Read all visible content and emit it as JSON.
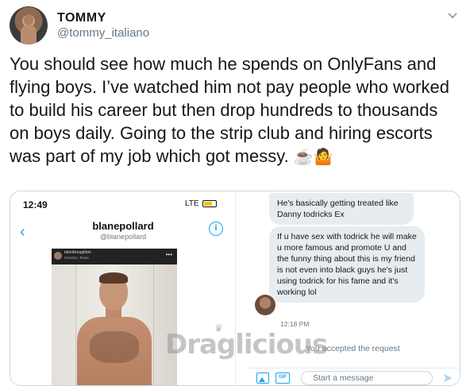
{
  "tweet": {
    "display_name": "TOMMY",
    "handle": "@tommy_italiano",
    "text": "You should see how much he spends on OnlyFans and flying boys. I’ve watched him not pay people who worked to build his career but then drop hundreds to thousands on boys daily. Going to the strip club and hiring escorts was part of my job which got messy.",
    "emojis": "☕🤷"
  },
  "left_screenshot": {
    "status_time": "12:49",
    "signal": "LTE",
    "profile_name": "blanepollard",
    "profile_handle": "@blanepollard",
    "post_user": "tatonbroughton",
    "post_location": "Houston, Texas"
  },
  "right_screenshot": {
    "messages": [
      "He's basically getting treated like Danny todricks Ex",
      "If u have sex with todrick he will make u more famous and promote U and the funny thing about this is my friend is not even into black guys he's just using todrick for his fame and it's working lol"
    ],
    "message_time": "12:18 PM",
    "system_note": "You accepted the request",
    "composer_placeholder": "Start a message"
  },
  "watermark": "Draglicious",
  "icons": {
    "chevron": "chevron-down-icon",
    "back": "back-arrow-icon",
    "info": "info-icon",
    "image": "image-icon",
    "gif": "gif-icon",
    "send": "send-icon"
  },
  "colors": {
    "accent": "#1da1f2",
    "bubble": "#e6ecf0",
    "muted": "#657786"
  }
}
